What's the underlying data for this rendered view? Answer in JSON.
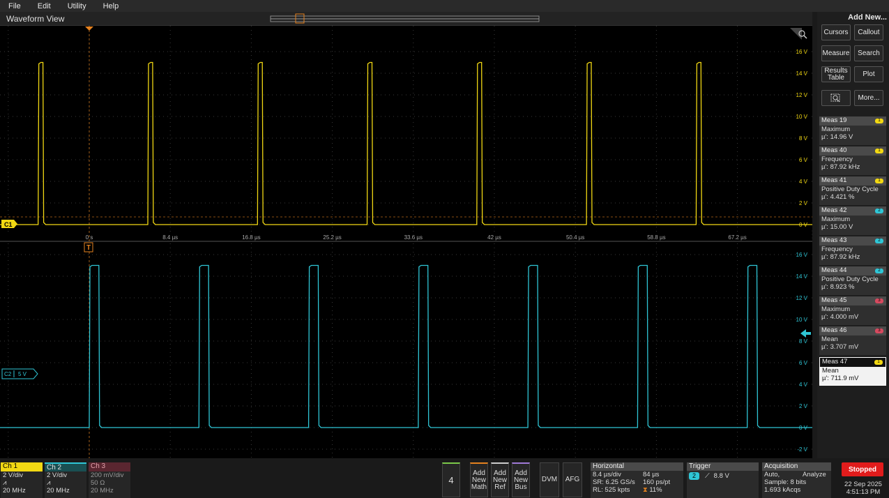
{
  "menu": [
    "File",
    "Edit",
    "Utility",
    "Help"
  ],
  "waveform_view": {
    "title": "Waveform View",
    "time_labels": [
      "0 s",
      "8.4 µs",
      "16.8 µs",
      "25.2 µs",
      "33.6 µs",
      "42 µs",
      "50.4 µs",
      "58.8 µs",
      "67.2 µs"
    ],
    "upper_volt_labels": [
      "16 V",
      "14 V",
      "12 V",
      "10 V",
      "8 V",
      "6 V",
      "4 V",
      "2 V",
      "0 V"
    ],
    "lower_volt_labels": [
      "16 V",
      "14 V",
      "12 V",
      "10 V",
      "8 V",
      "6 V",
      "4 V",
      "2 V",
      "0 V",
      "-2 V"
    ],
    "ch1_marker": "C1",
    "ch2_marker": "C2",
    "ch2_marker_value": "5 V",
    "trigger_marker": "T",
    "colors": {
      "ch1": "#f2d813",
      "ch2": "#2fc6d6",
      "ch3": "#d64a5f",
      "trigger": "#e5821f"
    }
  },
  "chart_data": [
    {
      "type": "line",
      "title": "",
      "series": [
        {
          "name": "Ch 1",
          "x": [
            0.0,
            1.5,
            11.4,
            15.0
          ],
          "y": [
            0,
            15,
            15,
            0
          ]
        }
      ],
      "xlabel": "",
      "ylabel": "",
      "xunit": "µs",
      "ylim": [
        -0.5,
        16
      ],
      "period_us": 11.37,
      "pulse_width_us": 0.5,
      "high_v": 15,
      "low_v": 0
    },
    {
      "type": "line",
      "title": "",
      "series": [
        {
          "name": "Ch 2",
          "x": [
            0.0,
            1.0
          ],
          "y": [
            0,
            15
          ]
        }
      ],
      "xlabel": "",
      "ylabel": "",
      "xunit": "µs",
      "ylim": [
        -2,
        16
      ],
      "period_us": 11.37,
      "pulse_width_us": 1.0,
      "high_v": 15,
      "low_v": 0
    }
  ],
  "right_panel": {
    "add_new": "Add New...",
    "buttons": [
      "Cursors",
      "Callout",
      "Measure",
      "Search",
      "Results Table",
      "Plot",
      "More..."
    ],
    "measurements": [
      {
        "name": "Meas 19",
        "type": "Maximum",
        "value": "µ': 14.96 V",
        "ch": "1"
      },
      {
        "name": "Meas 40",
        "type": "Frequency",
        "value": "µ': 87.92 kHz",
        "ch": "1"
      },
      {
        "name": "Meas 41",
        "type": "Positive Duty Cycle",
        "value": "µ': 4.421 %",
        "ch": "1"
      },
      {
        "name": "Meas 42",
        "type": "Maximum",
        "value": "µ': 15.00 V",
        "ch": "2"
      },
      {
        "name": "Meas 43",
        "type": "Frequency",
        "value": "µ': 87.92 kHz",
        "ch": "2"
      },
      {
        "name": "Meas 44",
        "type": "Positive Duty Cycle",
        "value": "µ': 8.923 %",
        "ch": "2"
      },
      {
        "name": "Meas 45",
        "type": "Maximum",
        "value": "µ': 4.000 mV",
        "ch": "3"
      },
      {
        "name": "Meas 46",
        "type": "Mean",
        "value": "µ': 3.707 mV",
        "ch": "3"
      },
      {
        "name": "Meas 47",
        "type": "Mean",
        "value": "µ': 711.9 mV",
        "ch": "1"
      }
    ]
  },
  "channels": [
    {
      "name": "Ch 1",
      "scale": "2 V/div",
      "bw": "20 MHz"
    },
    {
      "name": "Ch 2",
      "scale": "2 V/div",
      "bw": "20 MHz"
    },
    {
      "name": "Ch 3",
      "scale": "200 mV/div",
      "impedance": "50 Ω",
      "bw": "20 MHz"
    }
  ],
  "bottom_buttons": {
    "num": "4",
    "add_math": "Add New Math",
    "add_ref": "Add New Ref",
    "add_bus": "Add New Bus",
    "dvm": "DVM",
    "afg": "AFG"
  },
  "horizontal": {
    "title": "Horizontal",
    "scale": "8.4 µs/div",
    "duration": "84 µs",
    "sr": "SR: 6.25 GS/s",
    "ps": "160 ps/pt",
    "rl": "RL: 525 kpts",
    "pos": "11%"
  },
  "trigger": {
    "title": "Trigger",
    "source": "2",
    "level": "8.8 V"
  },
  "acquisition": {
    "title": "Acquisition",
    "mode": "Auto,",
    "analyze": "Analyze",
    "sample": "Sample: 8 bits",
    "acqs": "1.693 kAcqs"
  },
  "status": {
    "state": "Stopped",
    "date": "22 Sep 2025",
    "time": "4:51:13 PM"
  }
}
